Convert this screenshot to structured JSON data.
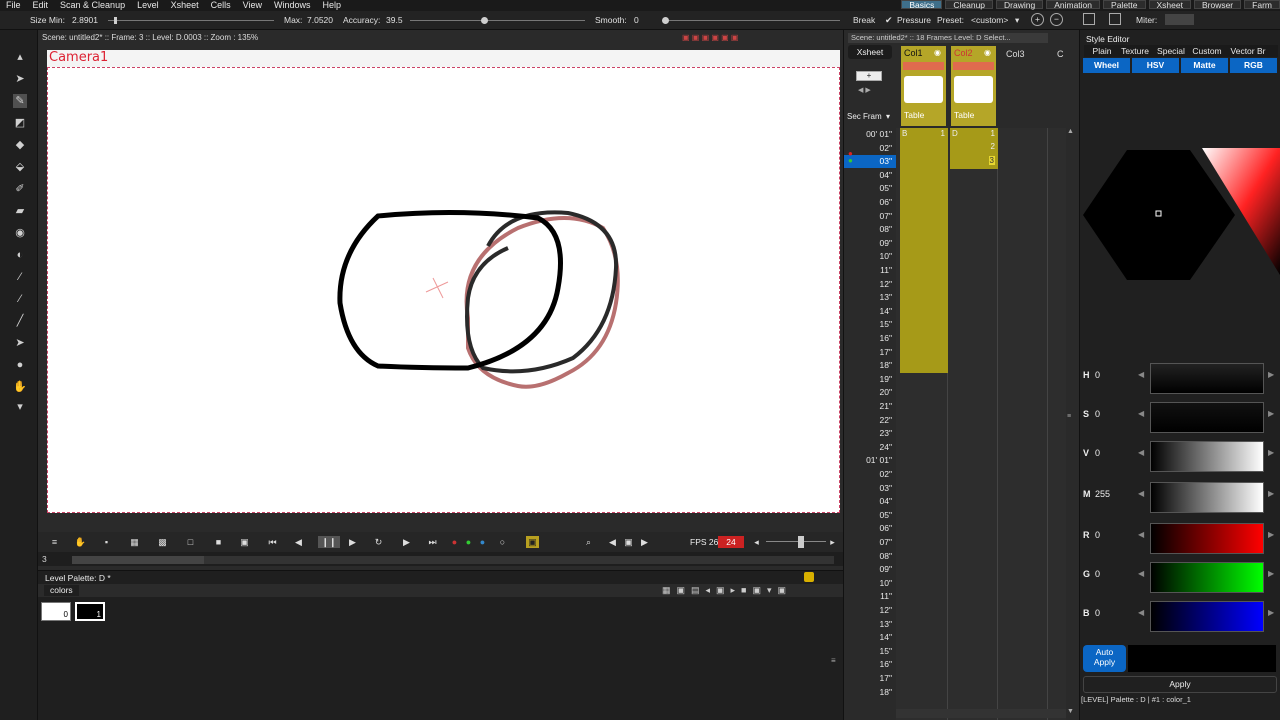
{
  "menu": [
    "File",
    "Edit",
    "Scan & Cleanup",
    "Level",
    "Xsheet",
    "Cells",
    "View",
    "Windows",
    "Help"
  ],
  "rooms": [
    {
      "label": "Basics",
      "active": true
    },
    {
      "label": "Cleanup",
      "active": false
    },
    {
      "label": "Drawing",
      "active": false
    },
    {
      "label": "Animation",
      "active": false
    },
    {
      "label": "Palette",
      "active": false
    },
    {
      "label": "Xsheet",
      "active": false
    },
    {
      "label": "Browser",
      "active": false
    },
    {
      "label": "Farm",
      "active": false
    }
  ],
  "tool_options": {
    "size_min_label": "Size Min:",
    "size_min_value": "2.8901",
    "max_label": "Max:",
    "max_value": "7.0520",
    "accuracy_label": "Accuracy:",
    "accuracy_value": "39.5",
    "smooth_label": "Smooth:",
    "smooth_value": "0",
    "break_label": "Break",
    "pressure_label": "Pressure",
    "preset_label": "Preset:",
    "preset_value": "<custom>",
    "miter_label": "Miter:"
  },
  "viewer": {
    "header": "Scene: untitled2*  ::  Frame: 3  ::  Level: D.0003  ::  Zoom : 135%",
    "camera_label": "Camera1",
    "fps_label": "FPS 26/",
    "fps_value": "24",
    "frame_field": "3"
  },
  "palette_panel": {
    "title": "Level Palette: D *",
    "tab": "colors",
    "chips": [
      "0",
      "1"
    ]
  },
  "xsheet": {
    "header": "Scene: untitled2*  ::  18 Frames  Level: D   Select...",
    "tab": "Xsheet",
    "sec_frame": "Sec Fram",
    "columns": [
      {
        "name": "Col1",
        "label": "Table",
        "level": "B",
        "first": "1"
      },
      {
        "name": "Col2",
        "label": "Table",
        "level": "D",
        "first": "1"
      },
      {
        "name": "Col3",
        "label": "",
        "level": "",
        "first": ""
      },
      {
        "name": "C",
        "label": "",
        "level": "",
        "first": ""
      }
    ],
    "col2_frames": [
      "2",
      "3"
    ],
    "rows": [
      "00' 01\"",
      "02\"",
      "03\"",
      "04\"",
      "05\"",
      "06\"",
      "07\"",
      "08\"",
      "09\"",
      "10\"",
      "11\"",
      "12\"",
      "13\"",
      "14\"",
      "15\"",
      "16\"",
      "17\"",
      "18\"",
      "19\"",
      "20\"",
      "21\"",
      "22\"",
      "23\"",
      "24\"",
      "01' 01\"",
      "02\"",
      "03\"",
      "04\"",
      "05\"",
      "06\"",
      "07\"",
      "08\"",
      "09\"",
      "10\"",
      "11\"",
      "12\"",
      "13\"",
      "14\"",
      "15\"",
      "16\"",
      "17\"",
      "18\""
    ]
  },
  "style_editor": {
    "title": "Style Editor",
    "tabs": [
      "Plain",
      "Texture",
      "Special",
      "Custom",
      "Vector Br"
    ],
    "modes": [
      "Wheel",
      "HSV",
      "Matte",
      "RGB"
    ],
    "channels": [
      {
        "label": "H",
        "value": "0"
      },
      {
        "label": "S",
        "value": "0"
      },
      {
        "label": "V",
        "value": "0"
      },
      {
        "label": "M",
        "value": "255"
      },
      {
        "label": "R",
        "value": "0"
      },
      {
        "label": "G",
        "value": "0"
      },
      {
        "label": "B",
        "value": "0"
      }
    ],
    "auto_apply": "Auto\nApply",
    "apply": "Apply",
    "status": "[LEVEL]  Palette : D | #1 : color_1"
  },
  "colors": {
    "accent": "#0b66c4",
    "cell": "#a69a18",
    "camera": "#dd2233",
    "stroke_red": "#b87070"
  }
}
